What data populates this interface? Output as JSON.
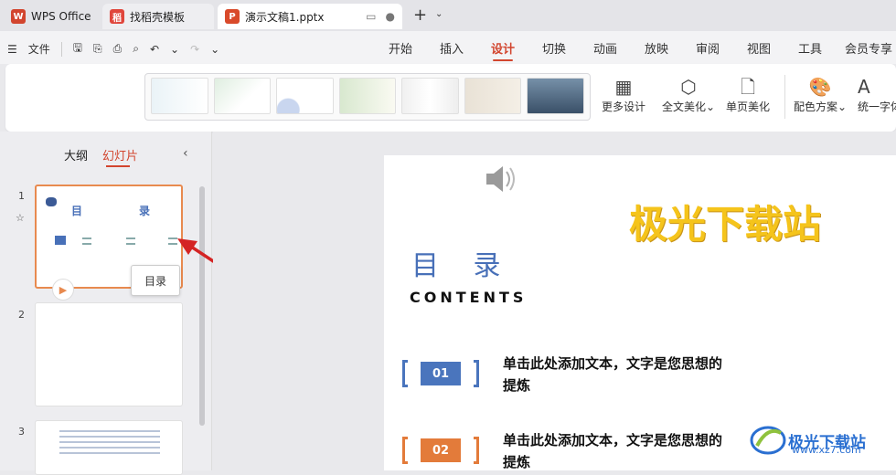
{
  "tabs": {
    "home": "WPS Office",
    "template": "找稻壳模板",
    "doc": "演示文稿1.pptx"
  },
  "menu": {
    "file": "文件",
    "tabs": [
      "开始",
      "插入",
      "设计",
      "切换",
      "动画",
      "放映",
      "审阅",
      "视图",
      "工具",
      "会员专享"
    ]
  },
  "ribbon": {
    "more_design": "更多设计",
    "full_beautify": "全文美化",
    "page_beautify": "单页美化",
    "color_scheme": "配色方案",
    "unify_font": "统一字体"
  },
  "panel": {
    "outline": "大纲",
    "slides": "幻灯片",
    "slide_numbers": [
      "1",
      "2",
      "3"
    ],
    "thumb1_title_left": "目",
    "thumb1_title_right": "录",
    "tooltip": "目录"
  },
  "slide": {
    "title": "目 录",
    "subtitle": "CONTENTS",
    "watermark": "极光下载站",
    "items": [
      {
        "num": "01",
        "text": "单击此处添加文本，文字是您思想的提炼",
        "color": "#4a75bd"
      },
      {
        "num": "02",
        "text": "单击此处添加文本，文字是您思想的提炼",
        "color": "#e37b3a"
      }
    ]
  },
  "brand": {
    "name": "极光下载站",
    "url": "www.xz7.com"
  },
  "colors": {
    "accent": "#d2452e",
    "title_blue": "#4870b8",
    "selection_orange": "#e88a4f"
  }
}
